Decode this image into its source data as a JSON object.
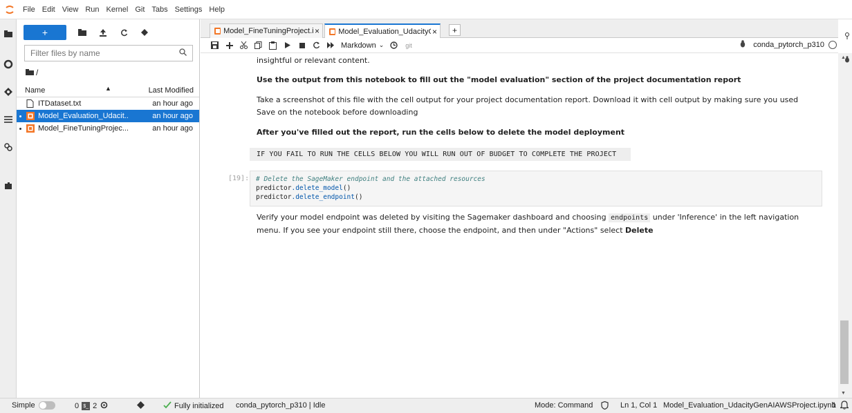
{
  "menubar": {
    "items": [
      "File",
      "Edit",
      "View",
      "Run",
      "Kernel",
      "Git",
      "Tabs",
      "Settings",
      "Help"
    ]
  },
  "filebrowser": {
    "new_label": "+",
    "filter_placeholder": "Filter files by name",
    "breadcrumb": "/",
    "header": {
      "name": "Name",
      "sort": "▲",
      "modified": "Last Modified"
    },
    "files": [
      {
        "name": "ITDataset.txt",
        "modified": "an hour ago",
        "type": "text",
        "selected": false
      },
      {
        "name": "Model_Evaluation_Udacit...",
        "modified": "an hour ago",
        "type": "notebook",
        "selected": true
      },
      {
        "name": "Model_FineTuningProjec...",
        "modified": "an hour ago",
        "type": "notebook",
        "selected": false
      }
    ]
  },
  "tabs": [
    {
      "label": "Model_FineTuningProject.ipy",
      "close": "×"
    },
    {
      "label": "Model_Evaluation_UdacityGe",
      "close": "×"
    }
  ],
  "new_tab_label": "+",
  "toolbar": {
    "cell_type": "Markdown",
    "git": "git",
    "kernel": "conda_pytorch_p310"
  },
  "notebook": {
    "p_insightful": "insightful or relevant content.",
    "h_use_output": "Use the output from this notebook to fill out the \"model evaluation\" section of the project documentation report",
    "p_screenshot": "Take a screenshot of this file with the cell output for your project documentation report. Download it with cell output by making sure you used Save on the notebook before downloading",
    "h_after_report": "After you've filled out the report, run the cells below to delete the model deployment",
    "code_budget": "IF YOU FAIL TO RUN THE CELLS BELOW YOU WILL RUN OUT OF BUDGET TO COMPLETE THE PROJECT",
    "prompt": "[19]:",
    "code_line1": "# Delete the SageMaker endpoint and the attached resources",
    "code_line2_obj": "predictor",
    "code_line2_method": ".delete_model",
    "code_line2_tail": "()",
    "code_line3_obj": "predictor",
    "code_line3_method": ".delete_endpoint",
    "code_line3_tail": "()",
    "p_verify_1": "Verify your model endpoint was deleted by visiting the Sagemaker dashboard and choosing ",
    "p_verify_code": "endpoints",
    "p_verify_2": " under 'Inference' in the left navigation menu. If you see your endpoint still there, choose the endpoint, and then under \"Actions\" select ",
    "p_verify_bold": "Delete"
  },
  "statusbar": {
    "simple": "Simple",
    "count_a": "0",
    "count_b": "2",
    "initialized": "Fully initialized",
    "kernel_status": "conda_pytorch_p310 | Idle",
    "mode": "Mode: Command",
    "position": "Ln 1, Col 1",
    "filename": "Model_Evaluation_UdacityGenAIAWSProject.ipynb",
    "notifications": "1"
  },
  "colors": {
    "accent": "#1976d2",
    "notebook_icon": "#f37626"
  }
}
